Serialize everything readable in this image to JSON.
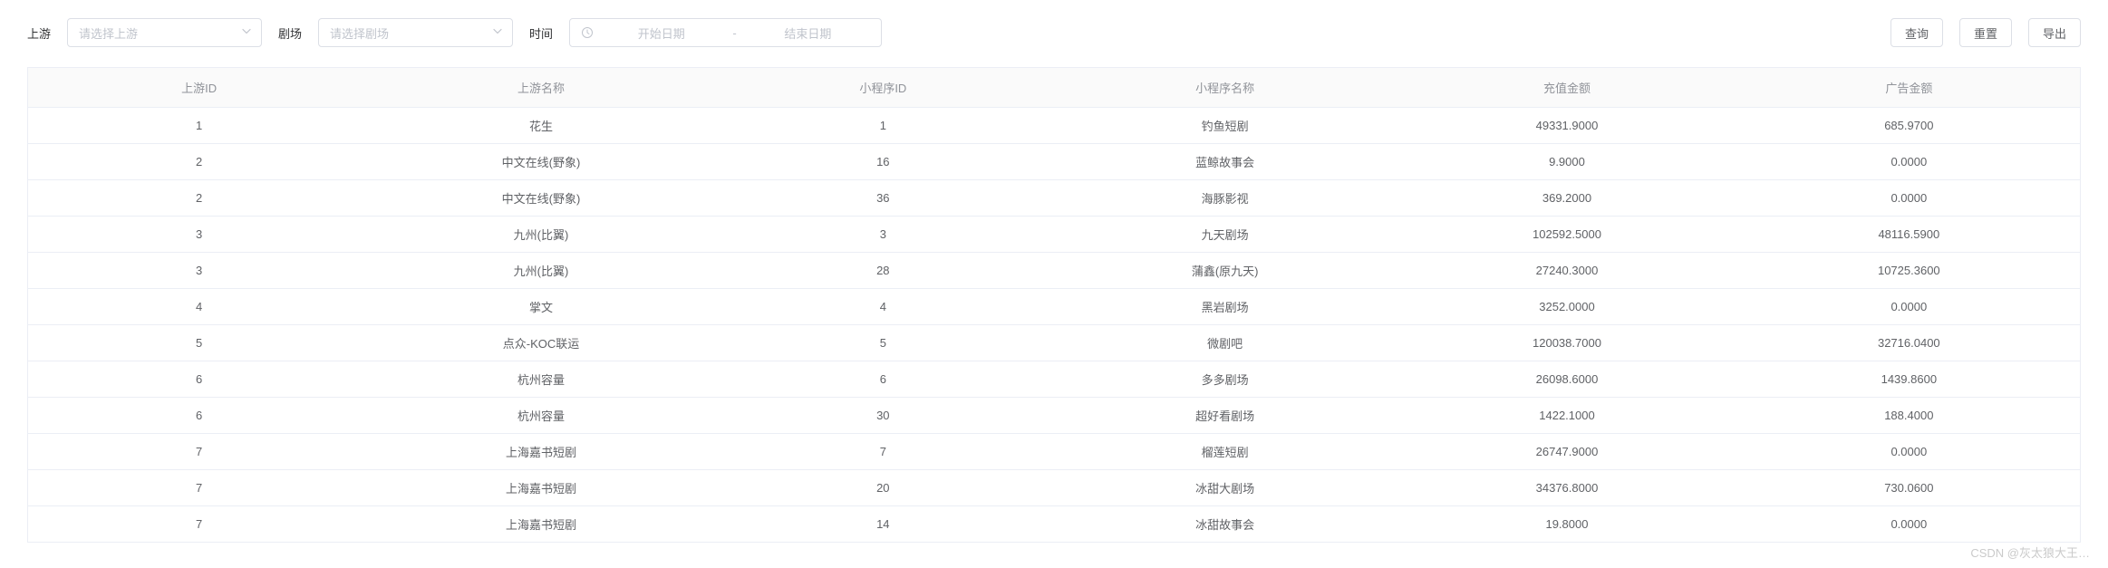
{
  "filters": {
    "upstream_label": "上游",
    "upstream_placeholder": "请选择上游",
    "theater_label": "剧场",
    "theater_placeholder": "请选择剧场",
    "time_label": "时间",
    "start_date_placeholder": "开始日期",
    "date_separator": "-",
    "end_date_placeholder": "结束日期"
  },
  "actions": {
    "query": "查询",
    "reset": "重置",
    "export": "导出"
  },
  "table": {
    "headers": {
      "upstream_id": "上游ID",
      "upstream_name": "上游名称",
      "applet_id": "小程序ID",
      "applet_name": "小程序名称",
      "recharge_amount": "充值金额",
      "ad_amount": "广告金额"
    },
    "rows": [
      {
        "upstream_id": "1",
        "upstream_name": "花生",
        "applet_id": "1",
        "applet_name": "钓鱼短剧",
        "recharge_amount": "49331.9000",
        "ad_amount": "685.9700"
      },
      {
        "upstream_id": "2",
        "upstream_name": "中文在线(野象)",
        "applet_id": "16",
        "applet_name": "蓝鲸故事会",
        "recharge_amount": "9.9000",
        "ad_amount": "0.0000"
      },
      {
        "upstream_id": "2",
        "upstream_name": "中文在线(野象)",
        "applet_id": "36",
        "applet_name": "海豚影视",
        "recharge_amount": "369.2000",
        "ad_amount": "0.0000"
      },
      {
        "upstream_id": "3",
        "upstream_name": "九州(比翼)",
        "applet_id": "3",
        "applet_name": "九天剧场",
        "recharge_amount": "102592.5000",
        "ad_amount": "48116.5900"
      },
      {
        "upstream_id": "3",
        "upstream_name": "九州(比翼)",
        "applet_id": "28",
        "applet_name": "蒲鑫(原九天)",
        "recharge_amount": "27240.3000",
        "ad_amount": "10725.3600"
      },
      {
        "upstream_id": "4",
        "upstream_name": "掌文",
        "applet_id": "4",
        "applet_name": "黑岩剧场",
        "recharge_amount": "3252.0000",
        "ad_amount": "0.0000"
      },
      {
        "upstream_id": "5",
        "upstream_name": "点众-KOC联运",
        "applet_id": "5",
        "applet_name": "微剧吧",
        "recharge_amount": "120038.7000",
        "ad_amount": "32716.0400"
      },
      {
        "upstream_id": "6",
        "upstream_name": "杭州容量",
        "applet_id": "6",
        "applet_name": "多多剧场",
        "recharge_amount": "26098.6000",
        "ad_amount": "1439.8600"
      },
      {
        "upstream_id": "6",
        "upstream_name": "杭州容量",
        "applet_id": "30",
        "applet_name": "超好看剧场",
        "recharge_amount": "1422.1000",
        "ad_amount": "188.4000"
      },
      {
        "upstream_id": "7",
        "upstream_name": "上海嘉书短剧",
        "applet_id": "7",
        "applet_name": "榴莲短剧",
        "recharge_amount": "26747.9000",
        "ad_amount": "0.0000"
      },
      {
        "upstream_id": "7",
        "upstream_name": "上海嘉书短剧",
        "applet_id": "20",
        "applet_name": "冰甜大剧场",
        "recharge_amount": "34376.8000",
        "ad_amount": "730.0600"
      },
      {
        "upstream_id": "7",
        "upstream_name": "上海嘉书短剧",
        "applet_id": "14",
        "applet_name": "冰甜故事会",
        "recharge_amount": "19.8000",
        "ad_amount": "0.0000"
      }
    ]
  },
  "watermark": "CSDN @灰太狼大王…"
}
